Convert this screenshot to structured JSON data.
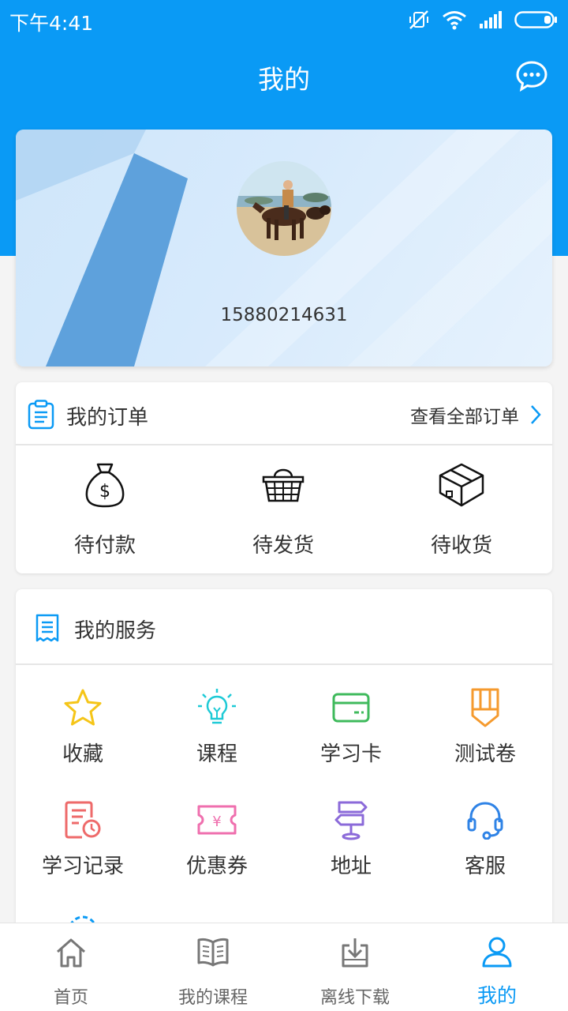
{
  "status_bar": {
    "time": "下午4:41"
  },
  "header": {
    "title": "我的"
  },
  "profile": {
    "phone": "15880214631"
  },
  "orders": {
    "title": "我的订单",
    "view_all": "查看全部订单",
    "items": [
      {
        "label": "待付款",
        "icon": "money-bag-icon"
      },
      {
        "label": "待发货",
        "icon": "basket-icon"
      },
      {
        "label": "待收货",
        "icon": "package-box-icon"
      }
    ]
  },
  "services": {
    "title": "我的服务",
    "items": [
      {
        "label": "收藏",
        "icon": "star-icon",
        "color": "#f5c518"
      },
      {
        "label": "课程",
        "icon": "lightbulb-icon",
        "color": "#1ecad6"
      },
      {
        "label": "学习卡",
        "icon": "card-icon",
        "color": "#3fba5c"
      },
      {
        "label": "测试卷",
        "icon": "pencil-icon",
        "color": "#f59a2e"
      },
      {
        "label": "学习记录",
        "icon": "record-icon",
        "color": "#ee6a6a"
      },
      {
        "label": "优惠券",
        "icon": "coupon-icon",
        "color": "#ef6fae"
      },
      {
        "label": "地址",
        "icon": "signpost-icon",
        "color": "#8b6ad9"
      },
      {
        "label": "客服",
        "icon": "headset-icon",
        "color": "#2f83e6"
      }
    ]
  },
  "tabbar": {
    "items": [
      {
        "label": "首页",
        "icon": "home-icon"
      },
      {
        "label": "我的课程",
        "icon": "book-icon"
      },
      {
        "label": "离线下载",
        "icon": "download-icon"
      },
      {
        "label": "我的",
        "icon": "user-icon"
      }
    ],
    "active_index": 3
  },
  "colors": {
    "primary": "#0a9af5"
  }
}
